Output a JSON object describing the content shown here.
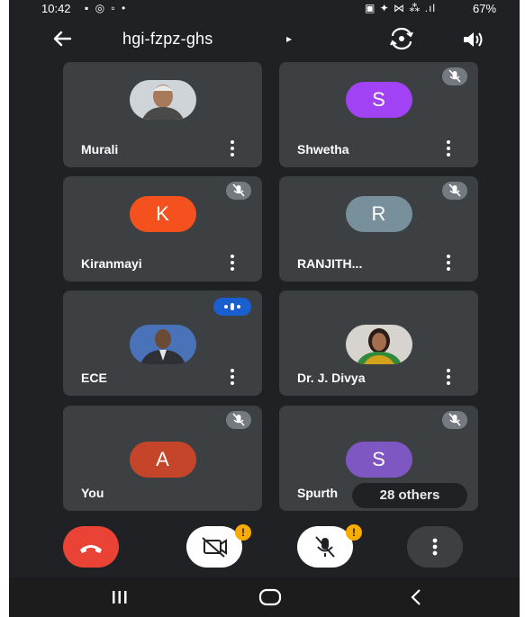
{
  "status_bar": {
    "time": "10:42",
    "icons_left": "▪ ◎ ▫ •",
    "icons_right": "▣ ✦ ⋈ ⁂ .ıl",
    "battery": "67%"
  },
  "header": {
    "meeting_code": "hgi-fzpz-ghs",
    "caret": "▸",
    "icons": [
      "back-arrow-icon",
      "switch-camera-icon",
      "speaker-icon"
    ]
  },
  "participants": [
    {
      "name": "Murali",
      "avatar": "photo",
      "muted": false
    },
    {
      "name": "Shwetha",
      "initial": "S",
      "avatar_color": "#a142f4",
      "muted": true
    },
    {
      "name": "Kiranmayi",
      "initial": "K",
      "avatar_color": "#f4511e",
      "muted": true
    },
    {
      "name": "RANJITH...",
      "initial": "R",
      "avatar_color": "#78909c",
      "muted": true
    },
    {
      "name": "ECE",
      "avatar": "photo",
      "speaking": true
    },
    {
      "name": "Dr. J. Divya",
      "avatar": "photo",
      "muted": false
    },
    {
      "name": "You",
      "initial": "A",
      "avatar_color": "#c5452b",
      "muted": true
    },
    {
      "name": "Spurth",
      "initial": "S",
      "avatar_color": "#7e57c2",
      "muted": true
    }
  ],
  "others": "28 others",
  "controls": {
    "end_call_color": "#ea4335",
    "camera_warning": "!",
    "mic_warning": "!"
  },
  "colors": {
    "background": "#202124",
    "tile": "#3c4043",
    "mute_badge": "#757a80",
    "speaking_badge": "#1a5fd0",
    "warning": "#f9ab00"
  }
}
